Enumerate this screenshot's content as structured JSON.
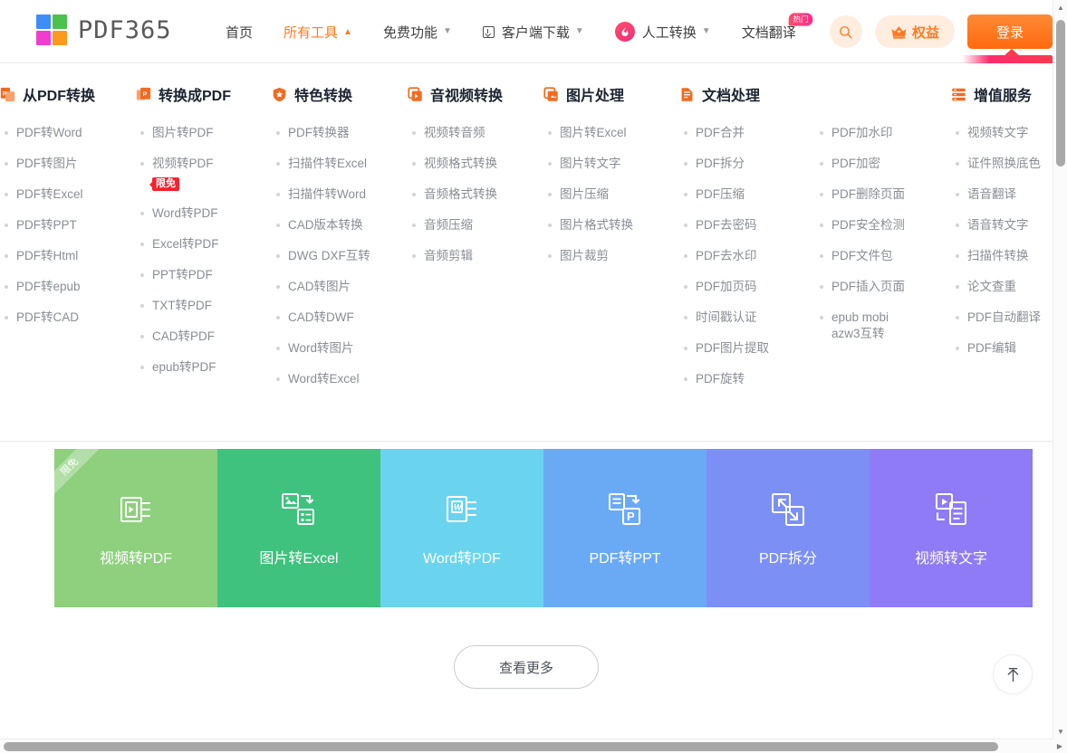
{
  "brand": {
    "name": "PDF365",
    "logo_colors": [
      "#3d8ef7",
      "#4ec04e",
      "#ef3ecf",
      "#fa9a1e"
    ]
  },
  "header": {
    "nav": [
      {
        "label": "首页",
        "icon": null,
        "caret": null,
        "active": false,
        "badge": null
      },
      {
        "label": "所有工具",
        "icon": null,
        "caret": "up",
        "active": true,
        "badge": null
      },
      {
        "label": "免费功能",
        "icon": null,
        "caret": "down",
        "active": false,
        "badge": null
      },
      {
        "label": "客户端下载",
        "icon": "download-icon",
        "caret": "down",
        "active": false,
        "badge": null
      },
      {
        "label": "人工转换",
        "icon": "flame-icon",
        "caret": "down",
        "active": false,
        "badge": null
      },
      {
        "label": "文档翻译",
        "icon": null,
        "caret": null,
        "active": false,
        "badge": "热门"
      }
    ],
    "search_icon": "search-icon",
    "rights_button": {
      "label": "权益",
      "icon": "crown-icon"
    },
    "login_button": {
      "label": "登录"
    },
    "accent_color": "#ff7a22",
    "login_bg": "#ff6a0d"
  },
  "mega_menu": {
    "columns": [
      {
        "title": "从PDF转换",
        "icon": "pdf-convert-from-icon",
        "lists": [
          [
            {
              "label": "PDF转Word"
            },
            {
              "label": "PDF转图片"
            },
            {
              "label": "PDF转Excel"
            },
            {
              "label": "PDF转PPT"
            },
            {
              "label": "PDF转Html"
            },
            {
              "label": "PDF转epub"
            },
            {
              "label": "PDF转CAD"
            }
          ]
        ]
      },
      {
        "title": "转换成PDF",
        "icon": "pdf-convert-to-icon",
        "lists": [
          [
            {
              "label": "图片转PDF"
            },
            {
              "label": "视频转PDF",
              "badge": "限免"
            },
            {
              "label": "Word转PDF"
            },
            {
              "label": "Excel转PDF"
            },
            {
              "label": "PPT转PDF"
            },
            {
              "label": "TXT转PDF"
            },
            {
              "label": "CAD转PDF"
            },
            {
              "label": "epub转PDF"
            }
          ]
        ]
      },
      {
        "title": "特色转换",
        "icon": "shield-star-icon",
        "lists": [
          [
            {
              "label": "PDF转换器"
            },
            {
              "label": "扫描件转Excel"
            },
            {
              "label": "扫描件转Word"
            },
            {
              "label": "CAD版本转换"
            },
            {
              "label": "DWG DXF互转"
            },
            {
              "label": "CAD转图片"
            },
            {
              "label": "CAD转DWF"
            },
            {
              "label": "Word转图片"
            },
            {
              "label": "Word转Excel"
            }
          ]
        ]
      },
      {
        "title": "音视频转换",
        "icon": "video-icon",
        "lists": [
          [
            {
              "label": "视频转音频"
            },
            {
              "label": "视频格式转换"
            },
            {
              "label": "音频格式转换"
            },
            {
              "label": "音频压缩"
            },
            {
              "label": "音频剪辑"
            }
          ]
        ]
      },
      {
        "title": "图片处理",
        "icon": "image-icon",
        "lists": [
          [
            {
              "label": "图片转Excel"
            },
            {
              "label": "图片转文字"
            },
            {
              "label": "图片压缩"
            },
            {
              "label": "图片格式转换"
            },
            {
              "label": "图片裁剪"
            }
          ]
        ]
      },
      {
        "title": "文档处理",
        "icon": "document-icon",
        "wide": true,
        "lists": [
          [
            {
              "label": "PDF合并"
            },
            {
              "label": "PDF拆分"
            },
            {
              "label": "PDF压缩"
            },
            {
              "label": "PDF去密码"
            },
            {
              "label": "PDF去水印"
            },
            {
              "label": "PDF加页码"
            },
            {
              "label": "时间戳认证"
            },
            {
              "label": "PDF图片提取"
            },
            {
              "label": "PDF旋转"
            }
          ],
          [
            {
              "label": "PDF加水印"
            },
            {
              "label": "PDF加密"
            },
            {
              "label": "PDF删除页面"
            },
            {
              "label": "PDF安全检测"
            },
            {
              "label": "PDF文件包"
            },
            {
              "label": "PDF插入页面"
            },
            {
              "label": "epub mobi azw3互转",
              "wrap": true
            }
          ]
        ]
      },
      {
        "title": "增值服务",
        "icon": "value-added-icon",
        "lists": [
          [
            {
              "label": "视频转文字"
            },
            {
              "label": "证件照换底色"
            },
            {
              "label": "语音翻译"
            },
            {
              "label": "语音转文字"
            },
            {
              "label": "扫描件转换"
            },
            {
              "label": "论文查重"
            },
            {
              "label": "PDF自动翻译"
            },
            {
              "label": "PDF编辑"
            }
          ]
        ]
      }
    ]
  },
  "tiles": [
    {
      "label": "视频转PDF",
      "color": "#8ed07e",
      "icon": "video-to-pdf-icon",
      "ribbon": "限免"
    },
    {
      "label": "图片转Excel",
      "color": "#3fc27d",
      "icon": "image-to-excel-icon",
      "ribbon": null
    },
    {
      "label": "Word转PDF",
      "color": "#6ad4ef",
      "icon": "word-to-pdf-icon",
      "ribbon": null
    },
    {
      "label": "PDF转PPT",
      "color": "#6aaaf5",
      "icon": "pdf-to-ppt-icon",
      "ribbon": null
    },
    {
      "label": "PDF拆分",
      "color": "#7b8ff5",
      "icon": "pdf-split-icon",
      "ribbon": null
    },
    {
      "label": "视频转文字",
      "color": "#8f7bf5",
      "icon": "video-to-text-icon",
      "ribbon": null
    }
  ],
  "footer": {
    "more_button": "查看更多",
    "back_to_top_icon": "arrow-up-icon"
  }
}
